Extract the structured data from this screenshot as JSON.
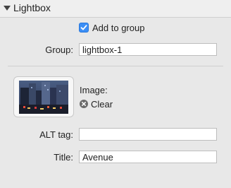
{
  "panel": {
    "title": "Lightbox"
  },
  "lightbox": {
    "add_to_group_label": "Add to group",
    "add_to_group_checked": true,
    "group_label": "Group:",
    "group_value": "lightbox-1"
  },
  "image": {
    "label": "Image:",
    "clear_label": "Clear"
  },
  "fields": {
    "alt_label": "ALT tag:",
    "alt_value": "",
    "title_label": "Title:",
    "title_value": "Avenue"
  },
  "colors": {
    "accent": "#3b8ef5",
    "panel_bg": "#e8e8e8"
  }
}
